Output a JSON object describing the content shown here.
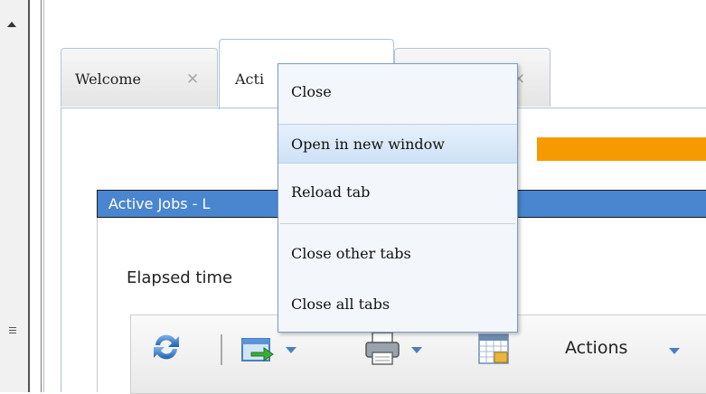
{
  "tabs": [
    {
      "label": "Welcome",
      "close": "✕"
    },
    {
      "label": "Acti"
    },
    {
      "close": "✕"
    }
  ],
  "panel": {
    "title": "Active Jobs - L",
    "elapsed_label": "Elapsed time"
  },
  "toolbar": {
    "actions_label": "Actions"
  },
  "context_menu": {
    "items": [
      {
        "label": "Close"
      },
      {
        "label": "Open in new window",
        "highlighted": true
      },
      {
        "label": "Reload tab"
      },
      {
        "label": "Close other tabs"
      },
      {
        "label": "Close all tabs"
      }
    ]
  },
  "colors": {
    "title_bar": "#4a86cf",
    "orange_bar": "#f59a00",
    "menu_highlight": "#cfe1f6"
  }
}
